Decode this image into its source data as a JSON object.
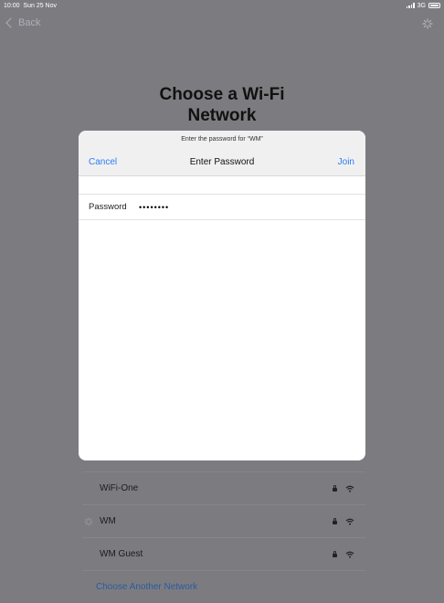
{
  "status_bar": {
    "time": "10:00",
    "date": "Sun 25 Nov",
    "network": "3G"
  },
  "nav": {
    "back_label": "Back"
  },
  "page": {
    "title_line1": "Choose a Wi-Fi",
    "title_line2": "Network"
  },
  "modal": {
    "prompt": "Enter the password for “WM”",
    "cancel_label": "Cancel",
    "title": "Enter Password",
    "join_label": "Join",
    "password_label": "Password",
    "password_value": "••••••••"
  },
  "networks": [
    {
      "name": "WiFi-One",
      "locked": true,
      "icon": "wifi-icon"
    },
    {
      "name": "WM",
      "locked": true,
      "icon": "wifi-icon",
      "connecting": true
    },
    {
      "name": "WM Guest",
      "locked": true,
      "icon": "wifi-icon"
    }
  ],
  "choose_another_label": "Choose Another Network",
  "colors": {
    "accent": "#2d7cf6",
    "link": "#2a5b9e",
    "dim_background": "#7c7c80"
  }
}
